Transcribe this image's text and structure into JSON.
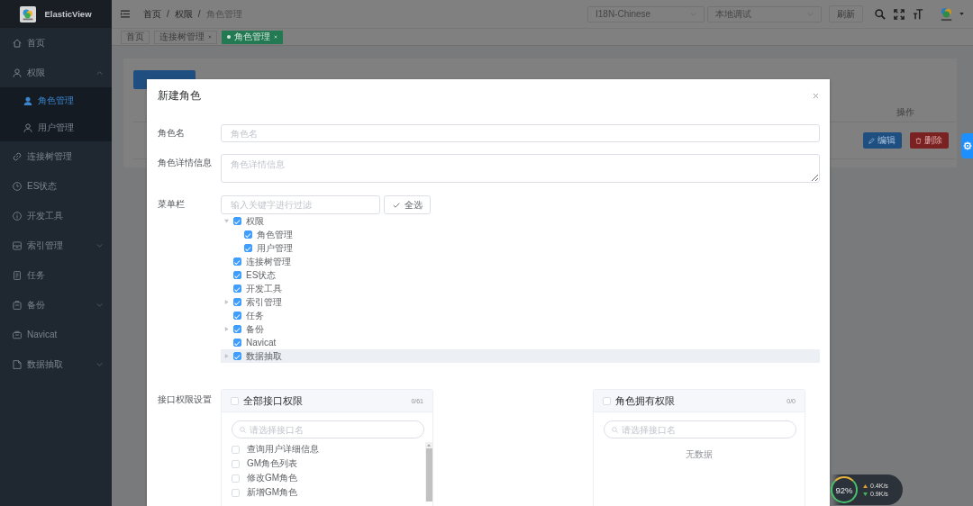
{
  "sidebar": {
    "title": "ElasticView",
    "items": [
      {
        "kind": "item",
        "label": "首页",
        "selected": false
      },
      {
        "kind": "submenu",
        "label": "权限",
        "selected": false,
        "expanded": true,
        "children": [
          {
            "kind": "item",
            "label": "角色管理",
            "selected": true
          },
          {
            "kind": "item",
            "label": "用户管理",
            "selected": false
          }
        ]
      },
      {
        "kind": "item",
        "label": "连接树管理",
        "selected": false
      },
      {
        "kind": "item",
        "label": "ES状态",
        "selected": false
      },
      {
        "kind": "item",
        "label": "开发工具",
        "selected": false
      },
      {
        "kind": "submenu",
        "label": "索引管理",
        "selected": false,
        "expanded": false
      },
      {
        "kind": "item",
        "label": "任务",
        "selected": false
      },
      {
        "kind": "submenu",
        "label": "备份",
        "selected": false,
        "expanded": false
      },
      {
        "kind": "item",
        "label": "Navicat",
        "selected": false
      },
      {
        "kind": "submenu",
        "label": "数据抽取",
        "selected": false,
        "expanded": false
      }
    ]
  },
  "header": {
    "breadcrumb": [
      {
        "label": "首页"
      },
      {
        "separator": "/",
        "label": "权限"
      },
      {
        "separator": "/",
        "label": "角色管理"
      }
    ],
    "language_select": "I18N-Chinese",
    "connection_select": "本地调试",
    "refresh_button": "刷新"
  },
  "tags": [
    {
      "label": "首页",
      "selected": false,
      "closable": false
    },
    {
      "label": "连接树管理",
      "selected": false,
      "closable": true
    },
    {
      "label": "角色管理",
      "selected": true,
      "closable": true
    }
  ],
  "table": {
    "columns": [
      {
        "label": "操作"
      }
    ],
    "rows": [
      {
        "actions": [
          {
            "kind": "edit",
            "label": "编辑"
          },
          {
            "kind": "delete",
            "label": "删除"
          }
        ]
      }
    ]
  },
  "dialog": {
    "title": "新建角色",
    "fields": [
      {
        "kind": "input",
        "label": "角色名",
        "placeholder": "角色名"
      },
      {
        "kind": "textarea",
        "label": "角色详情信息",
        "placeholder": "角色详情信息"
      }
    ],
    "menu_field": {
      "label": "菜单栏",
      "filter_placeholder": "输入关键字进行过滤",
      "select_all_button": "全选",
      "tree": [
        {
          "kind": "branch",
          "label": "权限",
          "checked": true,
          "expanded": true,
          "highlighted": false,
          "children": [
            {
              "kind": "leaf",
              "label": "角色管理",
              "checked": true,
              "highlighted": false
            },
            {
              "kind": "leaf",
              "label": "用户管理",
              "checked": true,
              "highlighted": false
            }
          ]
        },
        {
          "kind": "leaf",
          "label": "连接树管理",
          "checked": true,
          "highlighted": false
        },
        {
          "kind": "leaf",
          "label": "ES状态",
          "checked": true,
          "highlighted": false
        },
        {
          "kind": "leaf",
          "label": "开发工具",
          "checked": true,
          "highlighted": false
        },
        {
          "kind": "branch",
          "label": "索引管理",
          "checked": true,
          "expanded": false,
          "highlighted": false
        },
        {
          "kind": "leaf",
          "label": "任务",
          "checked": true,
          "highlighted": false
        },
        {
          "kind": "branch",
          "label": "备份",
          "checked": true,
          "expanded": false,
          "highlighted": false
        },
        {
          "kind": "leaf",
          "label": "Navicat",
          "checked": true,
          "highlighted": false
        },
        {
          "kind": "branch",
          "label": "数据抽取",
          "checked": true,
          "expanded": false,
          "highlighted": true
        }
      ]
    },
    "api_permissions": {
      "label": "接口权限设置",
      "source": {
        "title": "全部接口权限",
        "checked": false,
        "count": "0/61",
        "search_placeholder": "请选择接口名",
        "items": [
          {
            "label": "查询用户详细信息",
            "checked": false
          },
          {
            "label": "GM角色列表",
            "checked": false
          },
          {
            "label": "修改GM角色",
            "checked": false
          },
          {
            "label": "新增GM角色",
            "checked": false
          }
        ]
      },
      "target": {
        "title": "角色拥有权限",
        "checked": false,
        "count": "0/0",
        "search_placeholder": "请选择接口名",
        "empty_text": "无数据"
      }
    }
  },
  "speed_widget": {
    "usage": "92%",
    "upload": "0.4K/s",
    "download": "0.9K/s"
  }
}
